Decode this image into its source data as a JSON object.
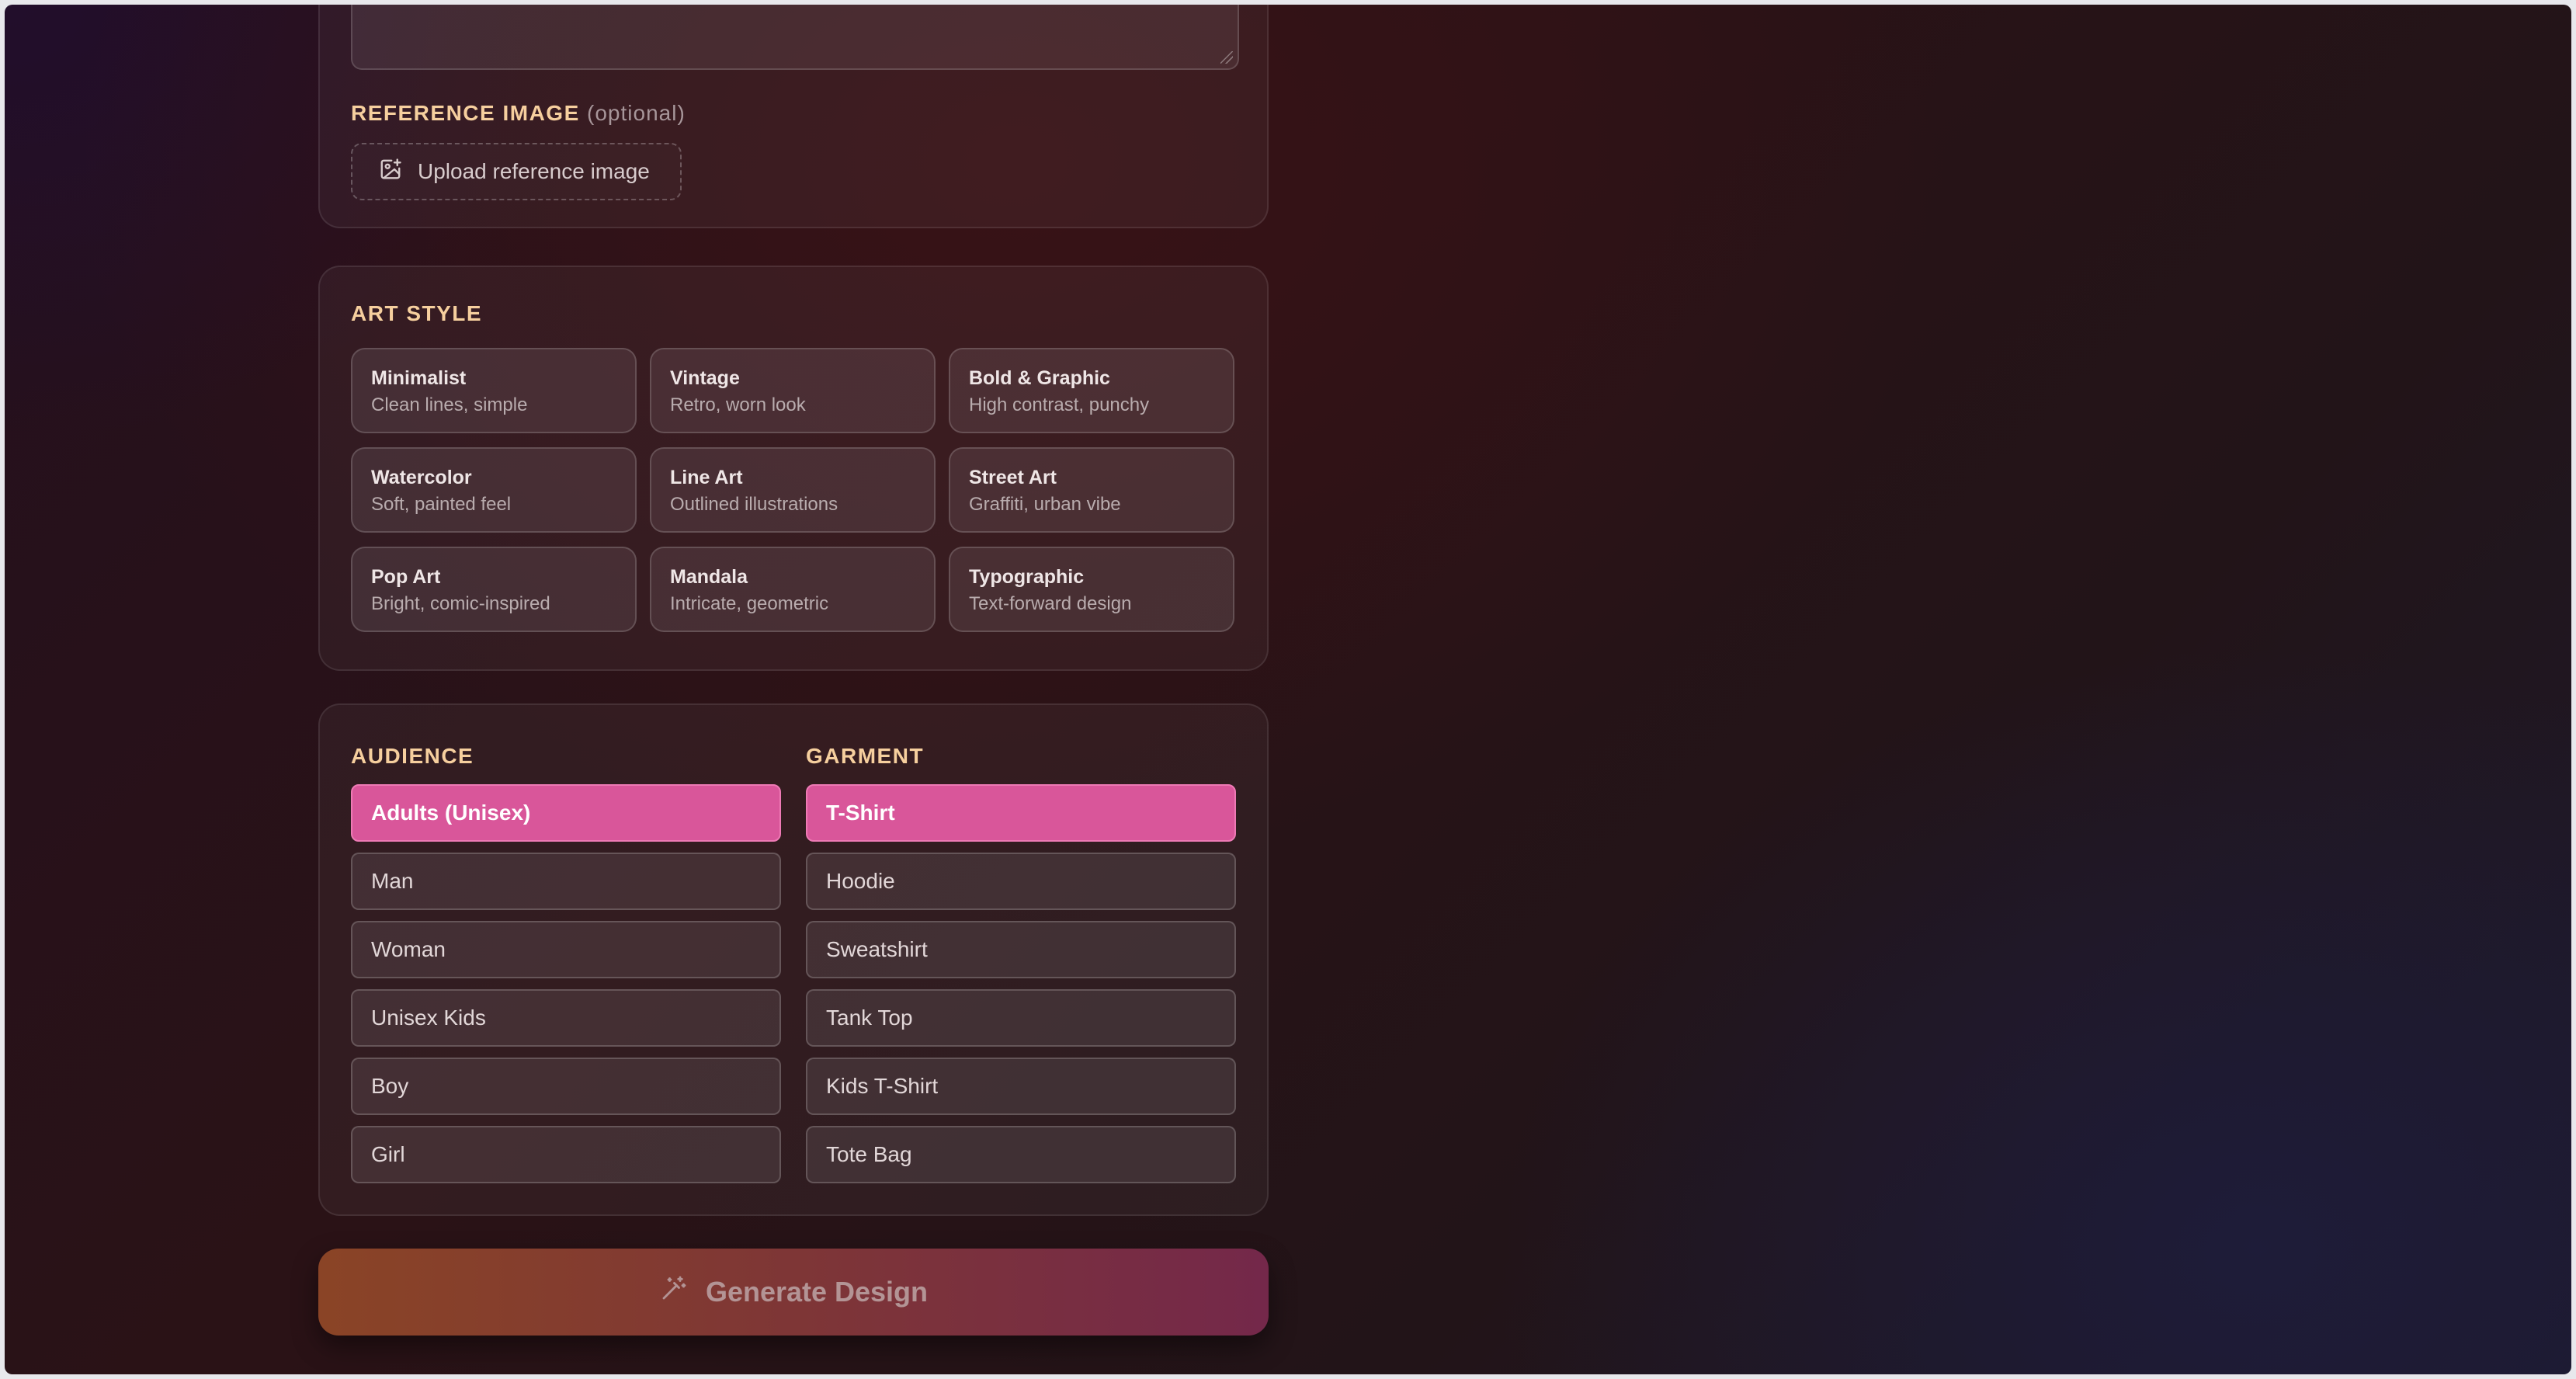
{
  "reference": {
    "label": "REFERENCE IMAGE",
    "optional": "(optional)",
    "upload_label": "Upload reference image"
  },
  "art_style": {
    "label": "ART STYLE",
    "options": [
      {
        "name": "Minimalist",
        "desc": "Clean lines, simple"
      },
      {
        "name": "Vintage",
        "desc": "Retro, worn look"
      },
      {
        "name": "Bold & Graphic",
        "desc": "High contrast, punchy"
      },
      {
        "name": "Watercolor",
        "desc": "Soft, painted feel"
      },
      {
        "name": "Line Art",
        "desc": "Outlined illustrations"
      },
      {
        "name": "Street Art",
        "desc": "Graffiti, urban vibe"
      },
      {
        "name": "Pop Art",
        "desc": "Bright, comic-inspired"
      },
      {
        "name": "Mandala",
        "desc": "Intricate, geometric"
      },
      {
        "name": "Typographic",
        "desc": "Text-forward design"
      }
    ]
  },
  "audience": {
    "label": "AUDIENCE",
    "options": [
      "Adults (Unisex)",
      "Man",
      "Woman",
      "Unisex Kids",
      "Boy",
      "Girl"
    ],
    "selected": "Adults (Unisex)"
  },
  "garment": {
    "label": "GARMENT",
    "options": [
      "T-Shirt",
      "Hoodie",
      "Sweatshirt",
      "Tank Top",
      "Kids T-Shirt",
      "Tote Bag"
    ],
    "selected": "T-Shirt"
  },
  "generate": {
    "label": "Generate Design"
  },
  "colors": {
    "accent_pink": "#d9569a",
    "label_gold": "#f6cf9e",
    "button_start": "#8a4426",
    "button_end": "#74284a"
  },
  "icons": {
    "upload": "image-plus-icon",
    "generate": "magic-wand-icon"
  }
}
